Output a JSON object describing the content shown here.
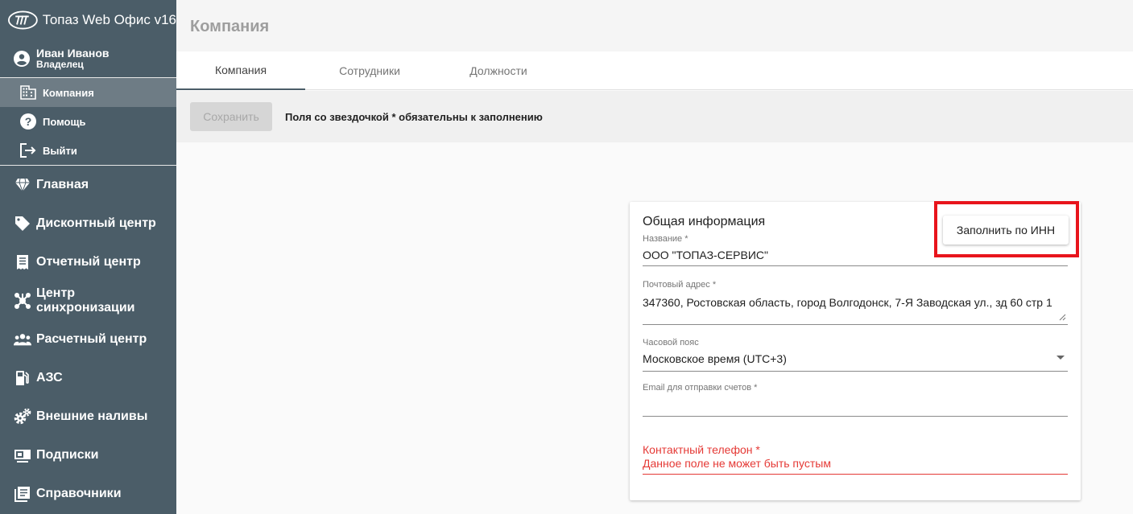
{
  "app": {
    "title": "Топаз Web Офис v16"
  },
  "user": {
    "name": "Иван Иванов",
    "role": "Владелец"
  },
  "sub_menu": [
    {
      "label": "Компания",
      "icon": "building-icon",
      "active": true
    },
    {
      "label": "Помощь",
      "icon": "help-icon",
      "active": false
    },
    {
      "label": "Выйти",
      "icon": "logout-icon",
      "active": false
    }
  ],
  "main_menu": [
    {
      "label": "Главная",
      "icon": "diamond-icon"
    },
    {
      "label": "Дисконтный центр",
      "icon": "tag-icon"
    },
    {
      "label": "Отчетный центр",
      "icon": "receipt-icon"
    },
    {
      "label": "Центр синхронизации",
      "icon": "sync-hub-icon"
    },
    {
      "label": "Расчетный центр",
      "icon": "users-icon"
    },
    {
      "label": "АЗС",
      "icon": "gas-pump-icon"
    },
    {
      "label": "Внешние наливы",
      "icon": "gears-icon"
    },
    {
      "label": "Подписки",
      "icon": "subscription-icon"
    },
    {
      "label": "Справочники",
      "icon": "book-icon"
    }
  ],
  "page": {
    "title": "Компания"
  },
  "tabs": [
    {
      "label": "Компания",
      "active": true
    },
    {
      "label": "Сотрудники",
      "active": false
    },
    {
      "label": "Должности",
      "active": false
    }
  ],
  "toolbar": {
    "save_label": "Сохранить",
    "hint": "Поля со звездочкой * обязательны к заполнению"
  },
  "card": {
    "title": "Общая информация",
    "fill_button": "Заполнить по ИНН",
    "name": {
      "label": "Название *",
      "value": "ООО \"ТОПАЗ-СЕРВИС\""
    },
    "address": {
      "label": "Почтовый адрес *",
      "value": "347360, Ростовская область, город Волгодонск, 7-Я Заводская ул., зд 60 стр 1"
    },
    "timezone": {
      "label": "Часовой пояс",
      "value": "Московское время (UTC+3)"
    },
    "email": {
      "label": "Email для отправки счетов *",
      "value": ""
    },
    "phone": {
      "label": "Контактный телефон *",
      "error": "Данное поле не может быть пустым"
    }
  },
  "colors": {
    "sidebar": "#4b5d68",
    "highlight": "#e8141c",
    "error": "#e53935"
  }
}
